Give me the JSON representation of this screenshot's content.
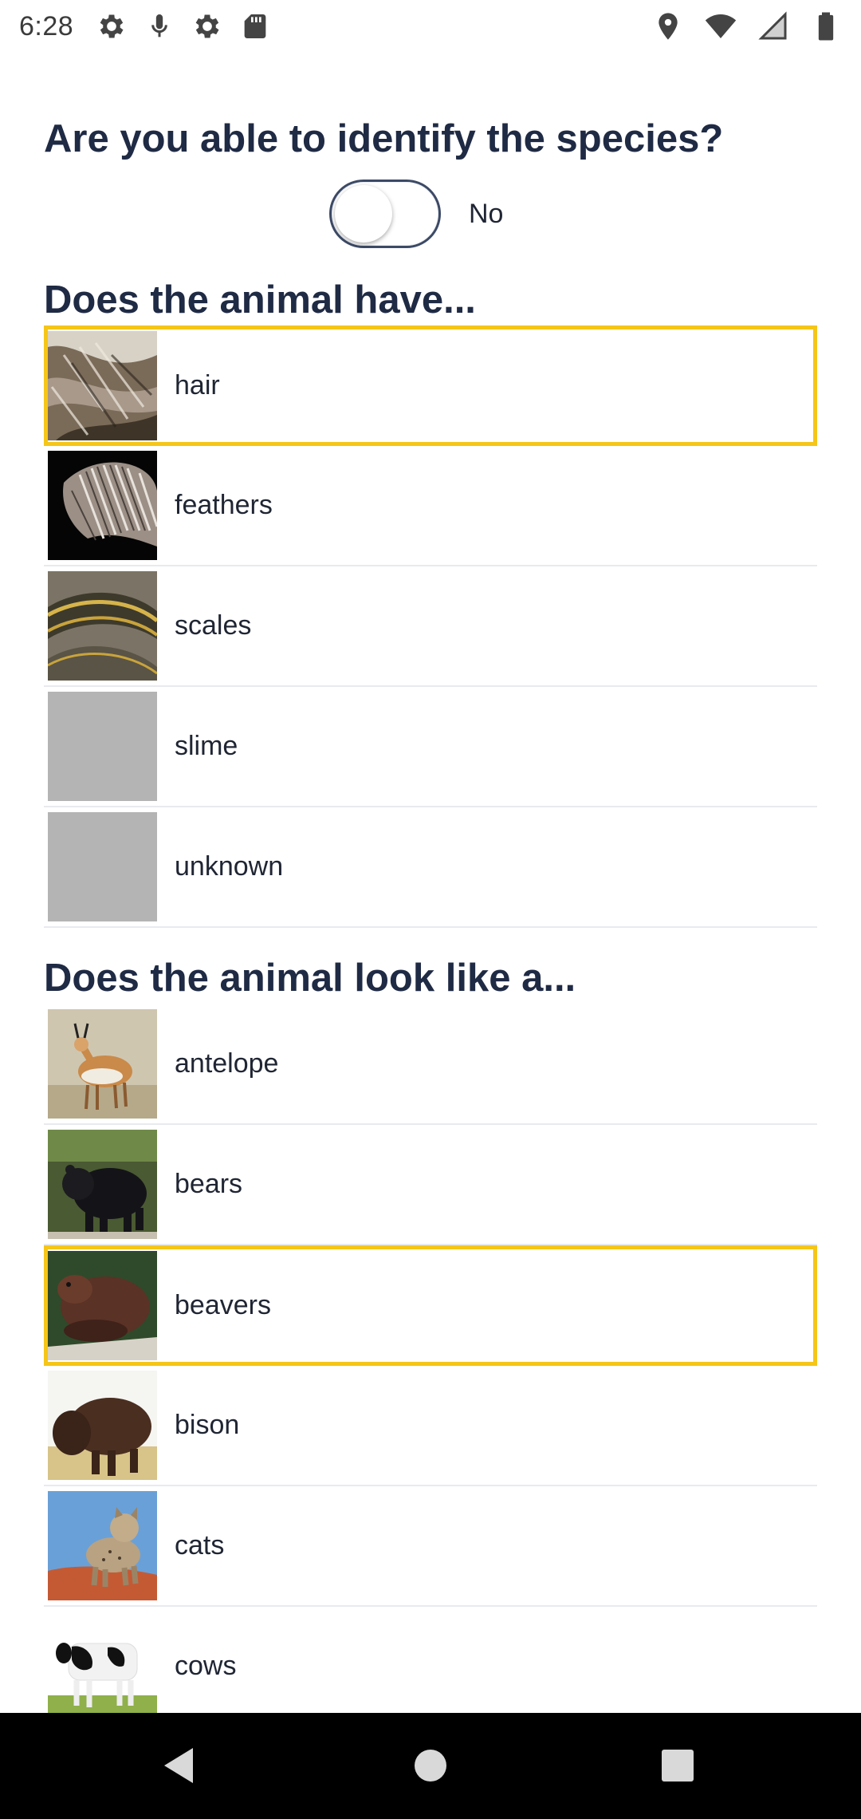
{
  "status_bar": {
    "time": "6:28",
    "left_icons": [
      "gear-icon",
      "microphone-icon",
      "gear-icon",
      "sd-card-icon"
    ],
    "right_icons": [
      "location-icon",
      "wifi-icon",
      "signal-icon",
      "battery-icon"
    ]
  },
  "question": {
    "title": "Are you able to identify the species?",
    "toggle_label": "No",
    "toggle_on": false
  },
  "section_covering": {
    "title": "Does the animal have...",
    "options": [
      {
        "label": "hair",
        "selected": true,
        "thumb": "fur-photo"
      },
      {
        "label": "feathers",
        "selected": false,
        "thumb": "feather-photo"
      },
      {
        "label": "scales",
        "selected": false,
        "thumb": "snake-scales-photo"
      },
      {
        "label": "slime",
        "selected": false,
        "thumb": "gray-placeholder"
      },
      {
        "label": "unknown",
        "selected": false,
        "thumb": "gray-placeholder"
      }
    ]
  },
  "section_lookalike": {
    "title": "Does the animal look like a...",
    "options": [
      {
        "label": "antelope",
        "selected": false,
        "thumb": "antelope-photo"
      },
      {
        "label": "bears",
        "selected": false,
        "thumb": "bear-photo"
      },
      {
        "label": "beavers",
        "selected": true,
        "thumb": "beaver-photo"
      },
      {
        "label": "bison",
        "selected": false,
        "thumb": "bison-photo"
      },
      {
        "label": "cats",
        "selected": false,
        "thumb": "bobcat-photo"
      },
      {
        "label": "cows",
        "selected": false,
        "thumb": "cow-photo"
      }
    ]
  },
  "colors": {
    "selection_border": "#f5c518",
    "heading": "#1f2a44",
    "divider": "#e8eaee"
  },
  "nav_bar": {
    "buttons": [
      "back-icon",
      "home-icon",
      "recents-icon"
    ]
  }
}
